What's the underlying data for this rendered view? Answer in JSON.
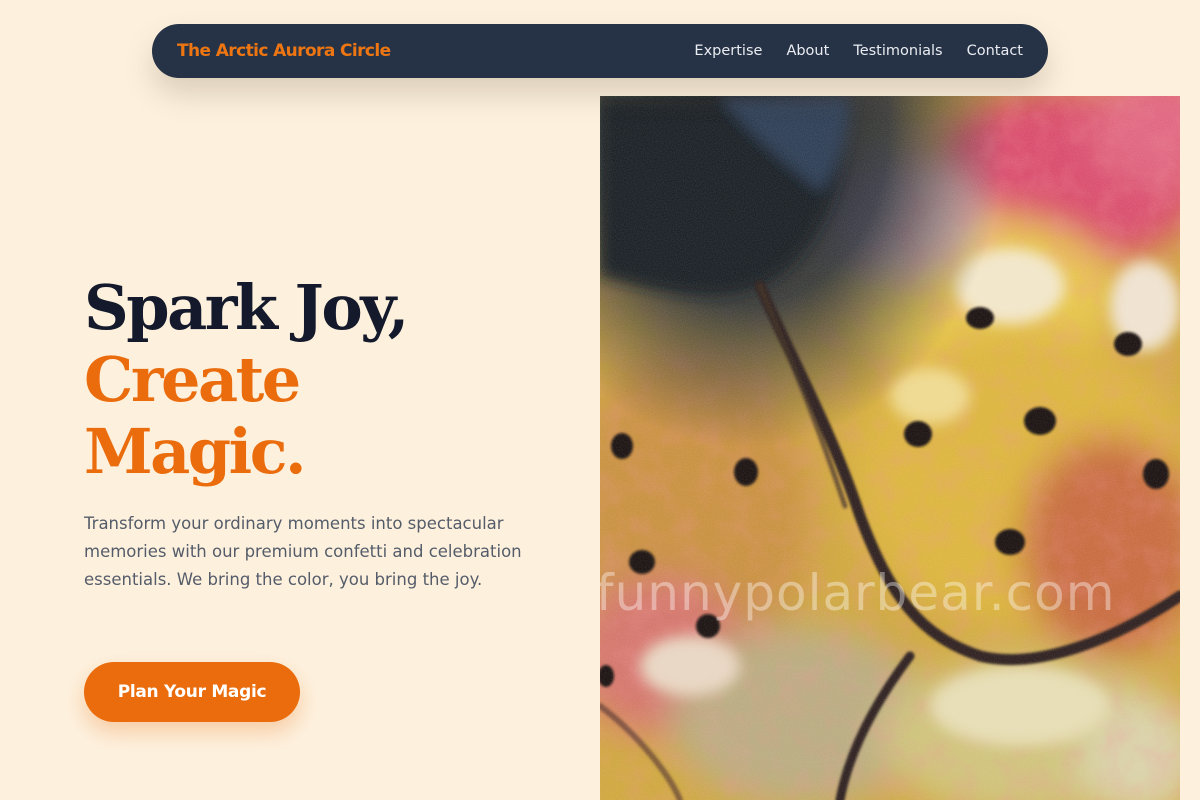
{
  "nav": {
    "brand": "The Arctic Aurora Circle",
    "links": [
      {
        "label": "Expertise"
      },
      {
        "label": "About"
      },
      {
        "label": "Testimonials"
      },
      {
        "label": "Contact"
      }
    ]
  },
  "hero": {
    "headline": {
      "line1": "Spark Joy,",
      "line2": "Create",
      "line3": "Magic."
    },
    "description": "Transform your ordinary moments into spectacular memories with our premium confetti and celebration essentials. We bring the color, you bring the joy.",
    "cta_label": "Plan Your Magic",
    "image_watermark": "funnypolarbear.com"
  },
  "colors": {
    "page_background": "#fdf1de",
    "nav_background": "#263245",
    "accent": "#ea6c0c",
    "headline_dark": "#141a2b",
    "body_text": "#555c69"
  }
}
